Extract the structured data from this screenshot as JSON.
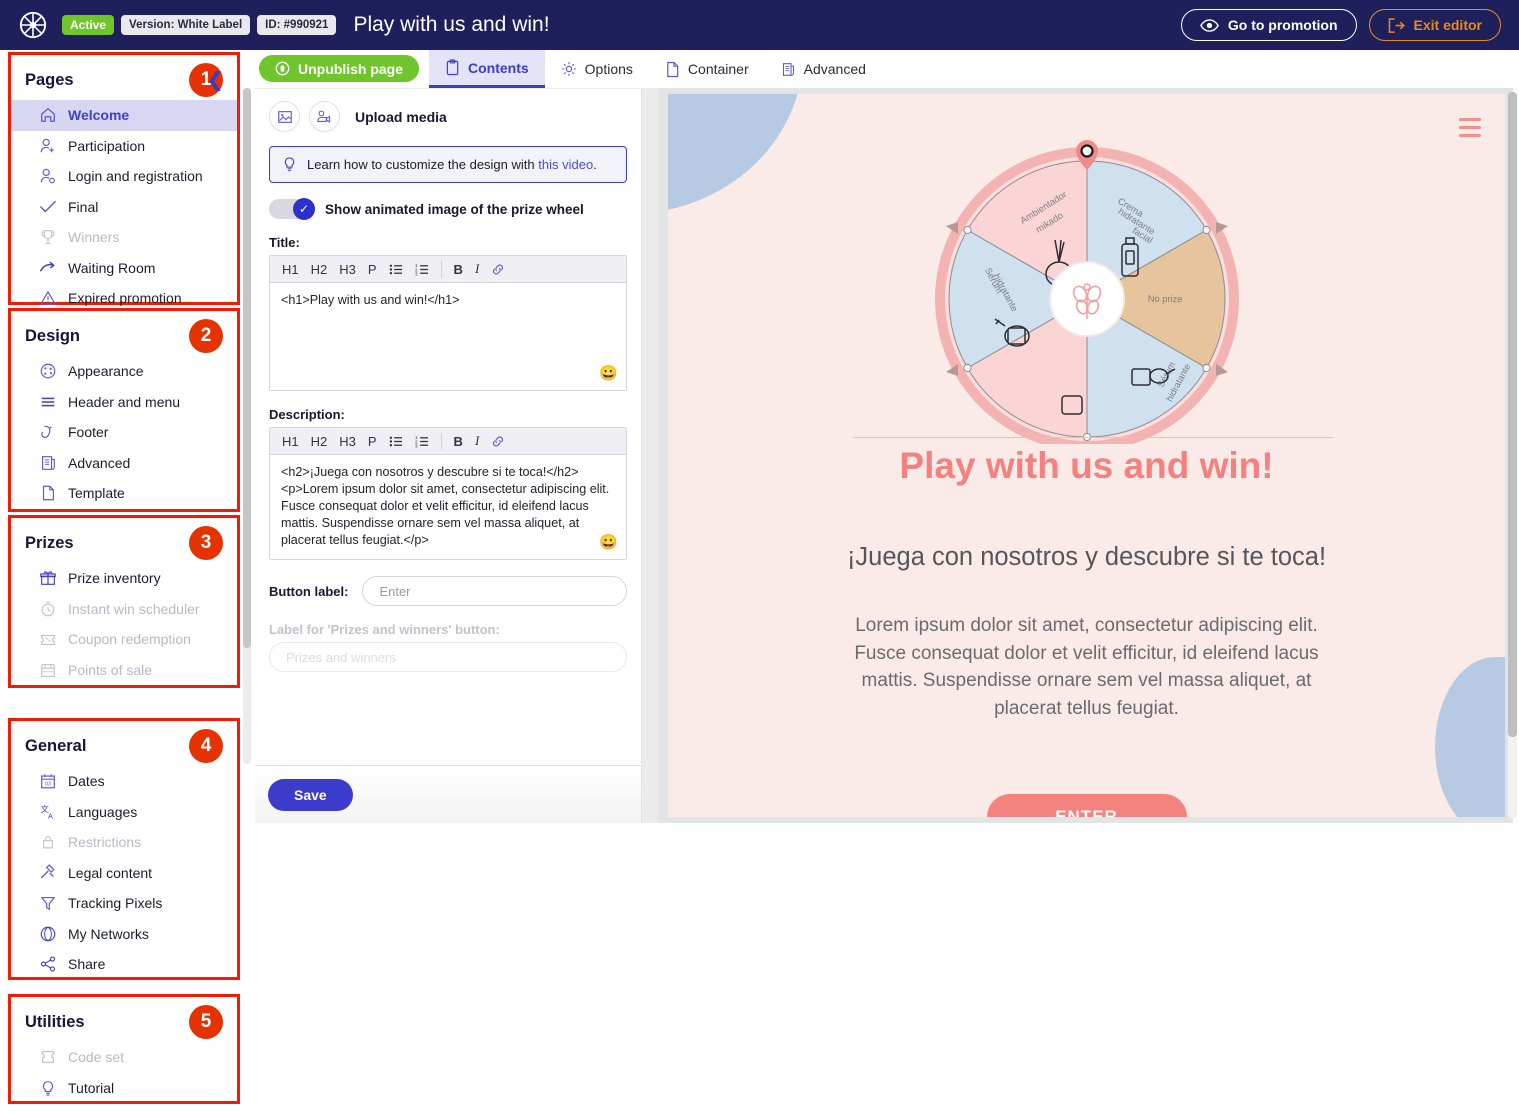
{
  "topbar": {
    "logo_icon": "wheel-logo-icon",
    "status_badge": "Active",
    "version_badge": "Version: White Label",
    "id_badge": "ID: #990921",
    "promotion_title": "Play with us and win!",
    "go_to_promotion_label": "Go to promotion",
    "go_to_promotion_icon": "eye-icon",
    "exit_editor_label": "Exit editor",
    "exit_editor_icon": "exit-arrow-icon"
  },
  "sidebar": {
    "collapse_icon": "chevron-left-icon",
    "groups": [
      {
        "title": "Pages",
        "badge": "1",
        "items": [
          {
            "label": "Welcome",
            "icon": "home-icon",
            "active": true
          },
          {
            "label": "Participation",
            "icon": "user-add-icon",
            "active": false
          },
          {
            "label": "Login and registration",
            "icon": "user-settings-icon",
            "active": false
          },
          {
            "label": "Final",
            "icon": "check-icon",
            "active": false
          },
          {
            "label": "Winners",
            "icon": "trophy-icon",
            "active": false,
            "dim": true
          },
          {
            "label": "Waiting Room",
            "icon": "hourglass-arrow-icon",
            "active": false
          },
          {
            "label": "Expired promotion",
            "icon": "warning-triangle-icon",
            "active": false
          }
        ]
      },
      {
        "title": "Design",
        "badge": "2",
        "items": [
          {
            "label": "Appearance",
            "icon": "palette-icon"
          },
          {
            "label": "Header and menu",
            "icon": "menu-lines-icon"
          },
          {
            "label": "Footer",
            "icon": "footer-icon"
          },
          {
            "label": "Advanced",
            "icon": "scroll-icon"
          },
          {
            "label": "Template",
            "icon": "page-icon"
          }
        ]
      },
      {
        "title": "Prizes",
        "badge": "3",
        "items": [
          {
            "label": "Prize inventory",
            "icon": "gift-icon"
          },
          {
            "label": "Instant win scheduler",
            "icon": "stopwatch-icon",
            "dim": true
          },
          {
            "label": "Coupon redemption",
            "icon": "coupon-icon",
            "dim": true
          },
          {
            "label": "Points of sale",
            "icon": "store-icon",
            "dim": true
          }
        ]
      },
      {
        "title": "General",
        "badge": "4",
        "items": [
          {
            "label": "Dates",
            "icon": "calendar-icon"
          },
          {
            "label": "Languages",
            "icon": "translate-icon"
          },
          {
            "label": "Restrictions",
            "icon": "lock-icon",
            "dim": true
          },
          {
            "label": "Legal content",
            "icon": "gavel-icon"
          },
          {
            "label": "Tracking Pixels",
            "icon": "funnel-icon"
          },
          {
            "label": "My Networks",
            "icon": "globe-icon"
          },
          {
            "label": "Share",
            "icon": "share-icon"
          }
        ]
      },
      {
        "title": "Utilities",
        "badge": "5",
        "items": [
          {
            "label": "Code set",
            "icon": "ticket-icon",
            "dim": true
          },
          {
            "label": "Tutorial",
            "icon": "lightbulb-icon"
          }
        ]
      }
    ]
  },
  "tabbar": {
    "unpublish_label": "Unpublish page",
    "unpublish_icon": "toggle-circle-icon",
    "tabs": [
      {
        "label": "Contents",
        "icon": "clipboard-icon",
        "active": true
      },
      {
        "label": "Options",
        "icon": "gear-icon",
        "active": false
      },
      {
        "label": "Container",
        "icon": "page-icon",
        "active": false
      },
      {
        "label": "Advanced",
        "icon": "scroll-icon",
        "active": false
      }
    ]
  },
  "editor": {
    "upload_media_label": "Upload media",
    "upload_image_icon": "image-icon",
    "upload_video_icon": "video-camera-icon",
    "tip_icon": "lightbulb-icon",
    "tip_text": "Learn how to customize the design with ",
    "tip_link": "this video",
    "tip_suffix": ".",
    "toggle_label": "Show animated image of the prize wheel",
    "toggle_on": true,
    "rte_buttons": [
      "H1",
      "H2",
      "H3",
      "P"
    ],
    "rte_list_icon": "bullet-list-icon",
    "rte_numlist_icon": "numbered-list-icon",
    "rte_bold": "B",
    "rte_italic": "I",
    "rte_link_icon": "link-icon",
    "emoji_icon": "emoji-icon",
    "title_field_label": "Title:",
    "title_value": "<h1>Play with us and win!</h1>",
    "description_field_label": "Description:",
    "description_value": "<h2>¡Juega con nosotros y descubre si te toca!</h2>\n<p>Lorem ipsum dolor sit amet, consectetur adipiscing elit. Fusce consequat dolor et velit efficitur, id eleifend lacus mattis. Suspendisse ornare sem vel massa aliquet, at placerat tellus feugiat.</p>",
    "button_label_field": "Button label:",
    "button_label_placeholder": "Enter",
    "prizes_winners_field": "Label for 'Prizes and winners' button:",
    "prizes_winners_placeholder": "Prizes and winners",
    "save_label": "Save"
  },
  "preview": {
    "menu_icon": "hamburger-menu-icon",
    "title": "Play with us and win!",
    "subtitle": "¡Juega con nosotros y descubre si te toca!",
    "body": "Lorem ipsum dolor sit amet, consectetur adipiscing elit. Fusce consequat dolor et velit efficitur, id eleifend lacus mattis. Suspendisse ornare sem vel massa aliquet, at placerat tellus feugiat.",
    "cta_label": "ENTER",
    "wheel": {
      "pointer_icon": "wheel-pointer-icon",
      "hub_icon": "flower-branch-icon",
      "segments": [
        {
          "label": "Crema hidratante facial",
          "color": "#cfe0ee"
        },
        {
          "label": "No prize",
          "color": "#e6c49c"
        },
        {
          "label": "Sérum hidratante",
          "color": "#cfe0ee"
        },
        {
          "label": "Ambientador mikado",
          "color": "#fbd5d6"
        },
        {
          "label": "Sérum hidratante",
          "color": "#cfe0ee"
        },
        {
          "label": "Ambientador mikado",
          "color": "#fbd5d6"
        }
      ],
      "rim_color": "#f3b3b2"
    }
  },
  "colors": {
    "brand_dark": "#1f1f5c",
    "accent_blue": "#3b3bcc",
    "green": "#6fc52b",
    "orange": "#e98a1f",
    "annotation_red": "#f61b00",
    "badge_red": "#e63200",
    "preview_pink": "#f4827f",
    "preview_bg": "#fbebe8"
  }
}
